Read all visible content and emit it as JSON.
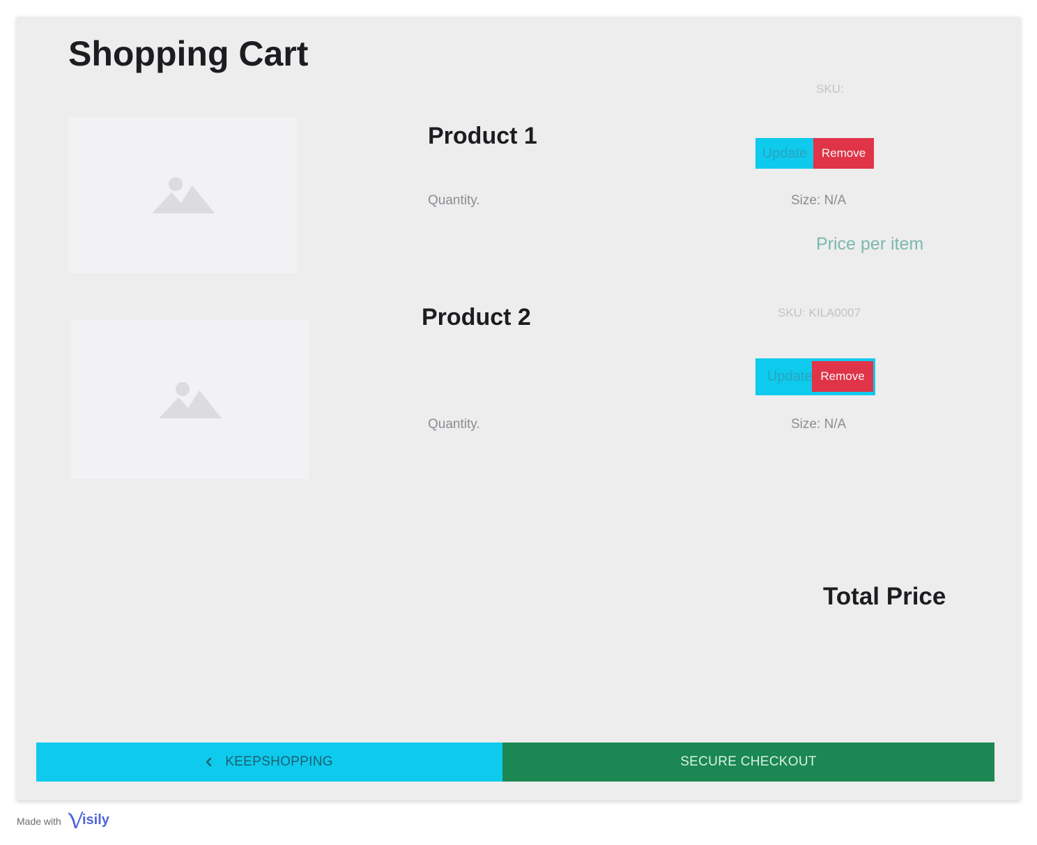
{
  "page": {
    "title": "Shopping Cart"
  },
  "products": [
    {
      "name": "Product 1",
      "sku": "SKU:",
      "quantity_label": "Quantity.",
      "size": "Size: N/A",
      "price_label": "Price per item",
      "update_label": "Update",
      "remove_label": "Remove"
    },
    {
      "name": "Product 2",
      "sku": "SKU: KILA0007",
      "quantity_label": "Quantity.",
      "size": "Size: N/A",
      "update_label": "Update",
      "remove_label": "Remove"
    }
  ],
  "summary": {
    "total_label": "Total Price"
  },
  "footer": {
    "keep_shopping_label": "KEEPSHOPPING",
    "checkout_label": "SECURE CHECKOUT"
  },
  "credit": {
    "made_with": "Made with",
    "brand": "isily"
  },
  "icons": {
    "thumbnail": "image-placeholder-icon",
    "back": "chevron-left-icon",
    "brand_logo": "visily-v-icon"
  },
  "colors": {
    "frame_bg": "#ededed",
    "accent_cyan": "#0ecaed",
    "remove_red": "#e03448",
    "checkout_green": "#1b8752",
    "price_teal": "#7bb8ad",
    "brand_blue": "#4f66d9"
  }
}
